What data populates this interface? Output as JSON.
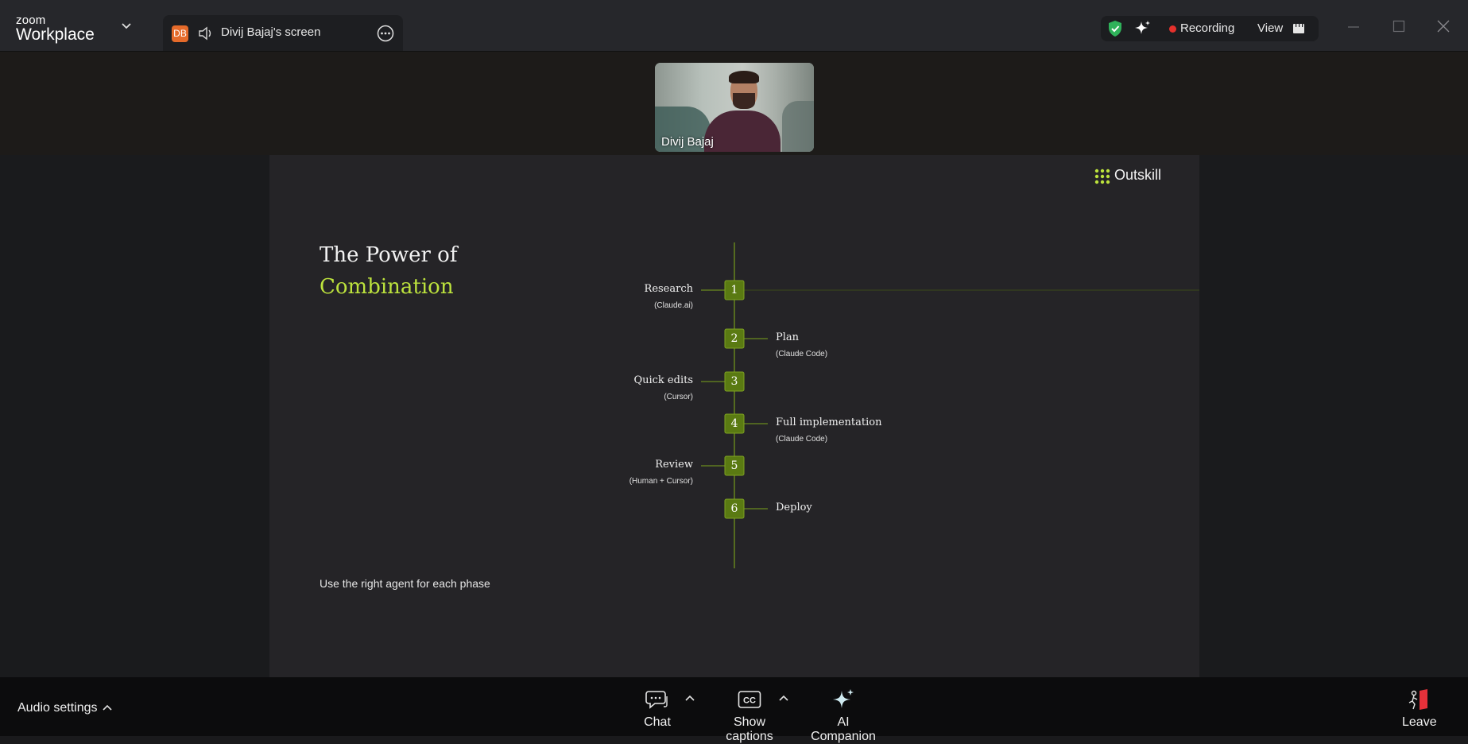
{
  "titlebar": {
    "logo_small": "zoom",
    "logo_big": "Workplace",
    "share_tab": {
      "avatar_initials": "DB",
      "label": "Divij Bajaj's screen"
    },
    "recording_label": "Recording",
    "view_label": "View"
  },
  "video": {
    "participant_name": "Divij Bajaj"
  },
  "slide": {
    "brand": "Outskill",
    "title_line1": "The Power of",
    "title_line2": "Combination",
    "subtitle": "Use the right agent for each phase",
    "steps": [
      {
        "num": "1",
        "label": "Research",
        "tool": "(Claude.ai)"
      },
      {
        "num": "2",
        "label": "Plan",
        "tool": "(Claude Code)"
      },
      {
        "num": "3",
        "label": "Quick edits",
        "tool": "(Cursor)"
      },
      {
        "num": "4",
        "label": "Full implementation",
        "tool": "(Claude Code)"
      },
      {
        "num": "5",
        "label": "Review",
        "tool": "(Human + Cursor)"
      },
      {
        "num": "6",
        "label": "Deploy",
        "tool": ""
      }
    ],
    "accent_color": "#bde33d",
    "node_color": "#5a7a12"
  },
  "toolbar": {
    "audio_settings": "Audio settings",
    "chat": "Chat",
    "captions": "Show captions",
    "ai_companion": "AI Companion",
    "leave": "Leave"
  }
}
